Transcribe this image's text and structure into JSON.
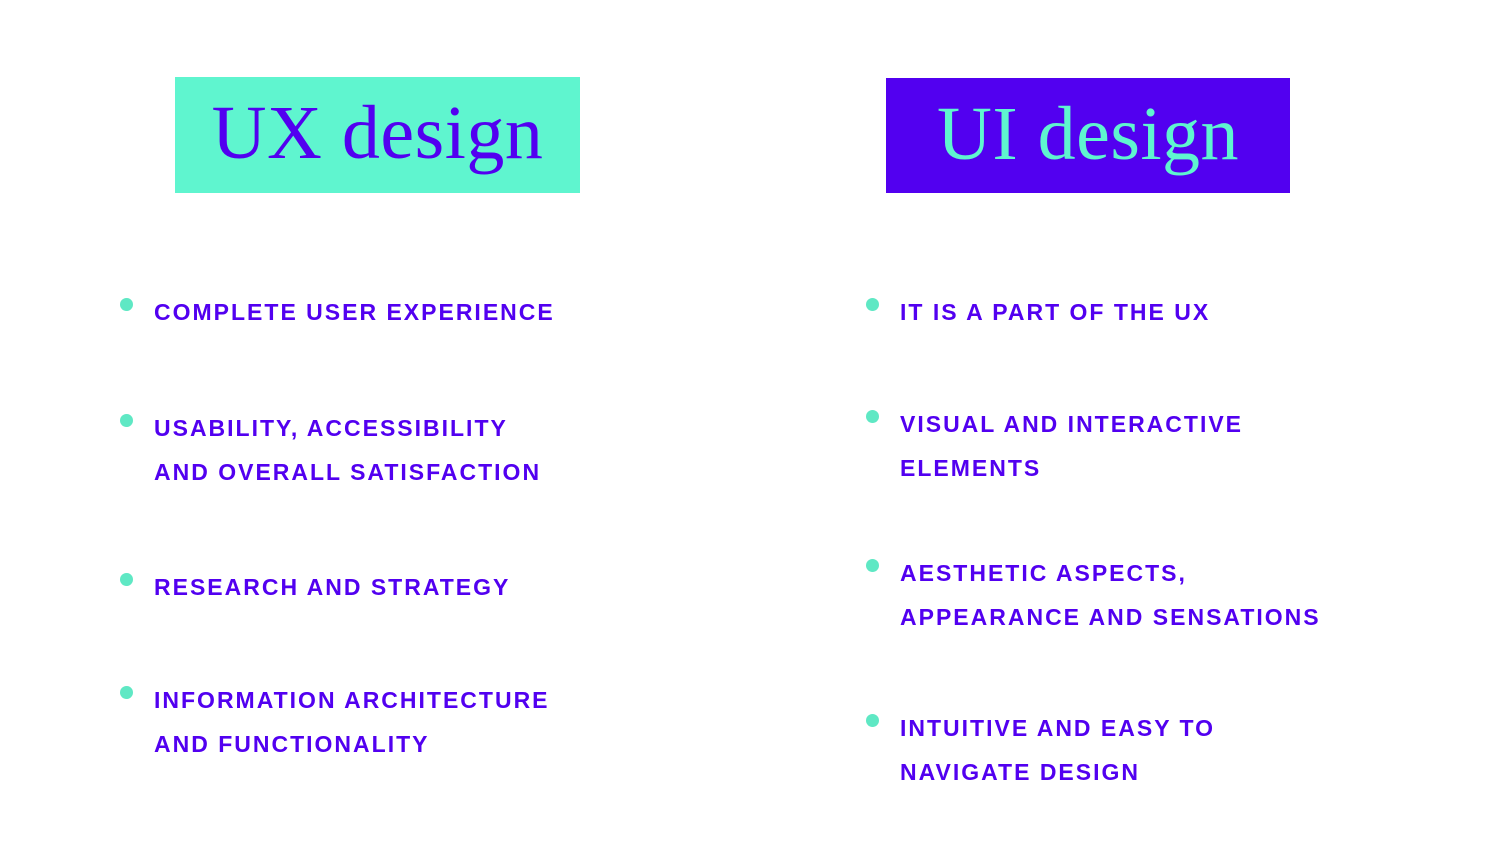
{
  "slide": {
    "background_color": "#ffffff",
    "accent_mint": "#5ff5cf",
    "accent_purple": "#5200f0",
    "bullet_color": "#5fe8c4"
  },
  "columns": [
    {
      "id": "ux",
      "header": {
        "label": "UX design",
        "background_color": "#5ff5cf",
        "text_color": "#5200f0"
      },
      "bullets": [
        {
          "text": "Complete user experience"
        },
        {
          "text": "Usability, accessibility\nand overall satisfaction"
        },
        {
          "text": "Research and strategy"
        },
        {
          "text": "Information architecture\nand functionality"
        }
      ]
    },
    {
      "id": "ui",
      "header": {
        "label": "UI design",
        "background_color": "#5200f0",
        "text_color": "#5ff5cf"
      },
      "bullets": [
        {
          "text": "It is a part of the UX"
        },
        {
          "text": "Visual and interactive\nelements"
        },
        {
          "text": "Aesthetic aspects,\nappearance and sensations"
        },
        {
          "text": "Intuitive and easy to\nnavigate design"
        }
      ]
    }
  ]
}
